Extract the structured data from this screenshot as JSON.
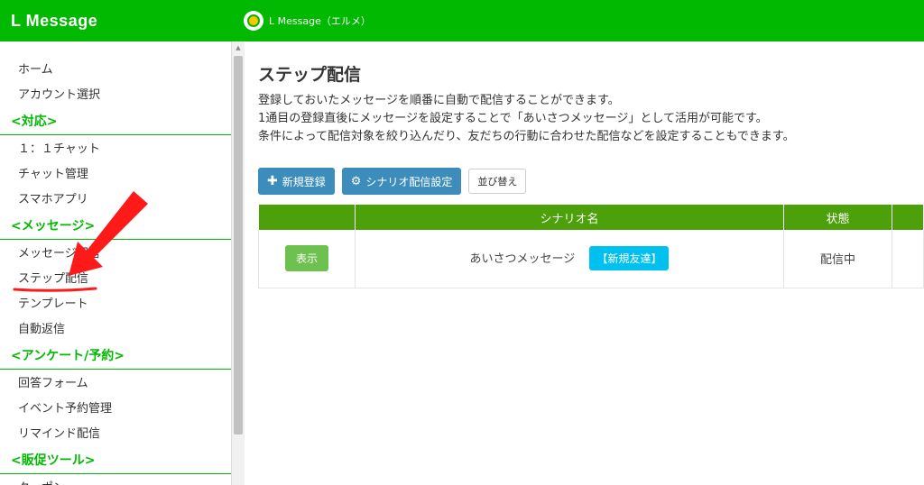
{
  "app": {
    "brand": "L Message",
    "top_title": "L Message（エルメ）"
  },
  "sidebar": {
    "items": [
      {
        "type": "item",
        "label": "ホーム",
        "name": "sidebar-item-home"
      },
      {
        "type": "item",
        "label": "アカウント選択",
        "name": "sidebar-item-account-select"
      },
      {
        "type": "header",
        "label": "<対応>",
        "name": "sidebar-section-support"
      },
      {
        "type": "item",
        "label": "１：１チャット",
        "name": "sidebar-item-one-to-one-chat"
      },
      {
        "type": "item",
        "label": "チャット管理",
        "name": "sidebar-item-chat-management"
      },
      {
        "type": "item",
        "label": "スマホアプリ",
        "name": "sidebar-item-smartphone-app"
      },
      {
        "type": "header",
        "label": "<メッセージ>",
        "name": "sidebar-section-message"
      },
      {
        "type": "item",
        "label": "メッセージ配信",
        "name": "sidebar-item-message-delivery"
      },
      {
        "type": "item",
        "label": "ステップ配信",
        "name": "sidebar-item-step-delivery"
      },
      {
        "type": "item",
        "label": "テンプレート",
        "name": "sidebar-item-template"
      },
      {
        "type": "item",
        "label": "自動返信",
        "name": "sidebar-item-auto-reply"
      },
      {
        "type": "header",
        "label": "<アンケート/予約>",
        "name": "sidebar-section-survey-reservation"
      },
      {
        "type": "item",
        "label": "回答フォーム",
        "name": "sidebar-item-answer-form"
      },
      {
        "type": "item",
        "label": "イベント予約管理",
        "name": "sidebar-item-event-reservation"
      },
      {
        "type": "item",
        "label": "リマインド配信",
        "name": "sidebar-item-remind-delivery"
      },
      {
        "type": "header",
        "label": "<販促ツール>",
        "name": "sidebar-section-promotion-tools"
      },
      {
        "type": "item",
        "label": "クーポン",
        "name": "sidebar-item-coupon"
      }
    ]
  },
  "main": {
    "title": "ステップ配信",
    "description": [
      "登録しておいたメッセージを順番に自動で配信することができます。",
      "1通目の登録直後にメッセージを設定することで「あいさつメッセージ」として活用が可能です。",
      "条件によって配信対象を絞り込んだり、友だちの行動に合わせた配信などを設定することもできます。"
    ],
    "toolbar": {
      "new_label": "新規登録",
      "scenario_settings_label": "シナリオ配信設定",
      "sort_label": "並び替え"
    },
    "table": {
      "headers": [
        "",
        "シナリオ名",
        "状態",
        ""
      ],
      "rows": [
        {
          "action": "表示",
          "name": "あいさつメッセージ",
          "tag": "【新規友達】",
          "status": "配信中"
        }
      ]
    }
  },
  "colors": {
    "brand_green": "#00b900",
    "table_header": "#4ca00a",
    "button_blue": "#3c8dbc",
    "annotation_red": "#ff1a1a"
  }
}
